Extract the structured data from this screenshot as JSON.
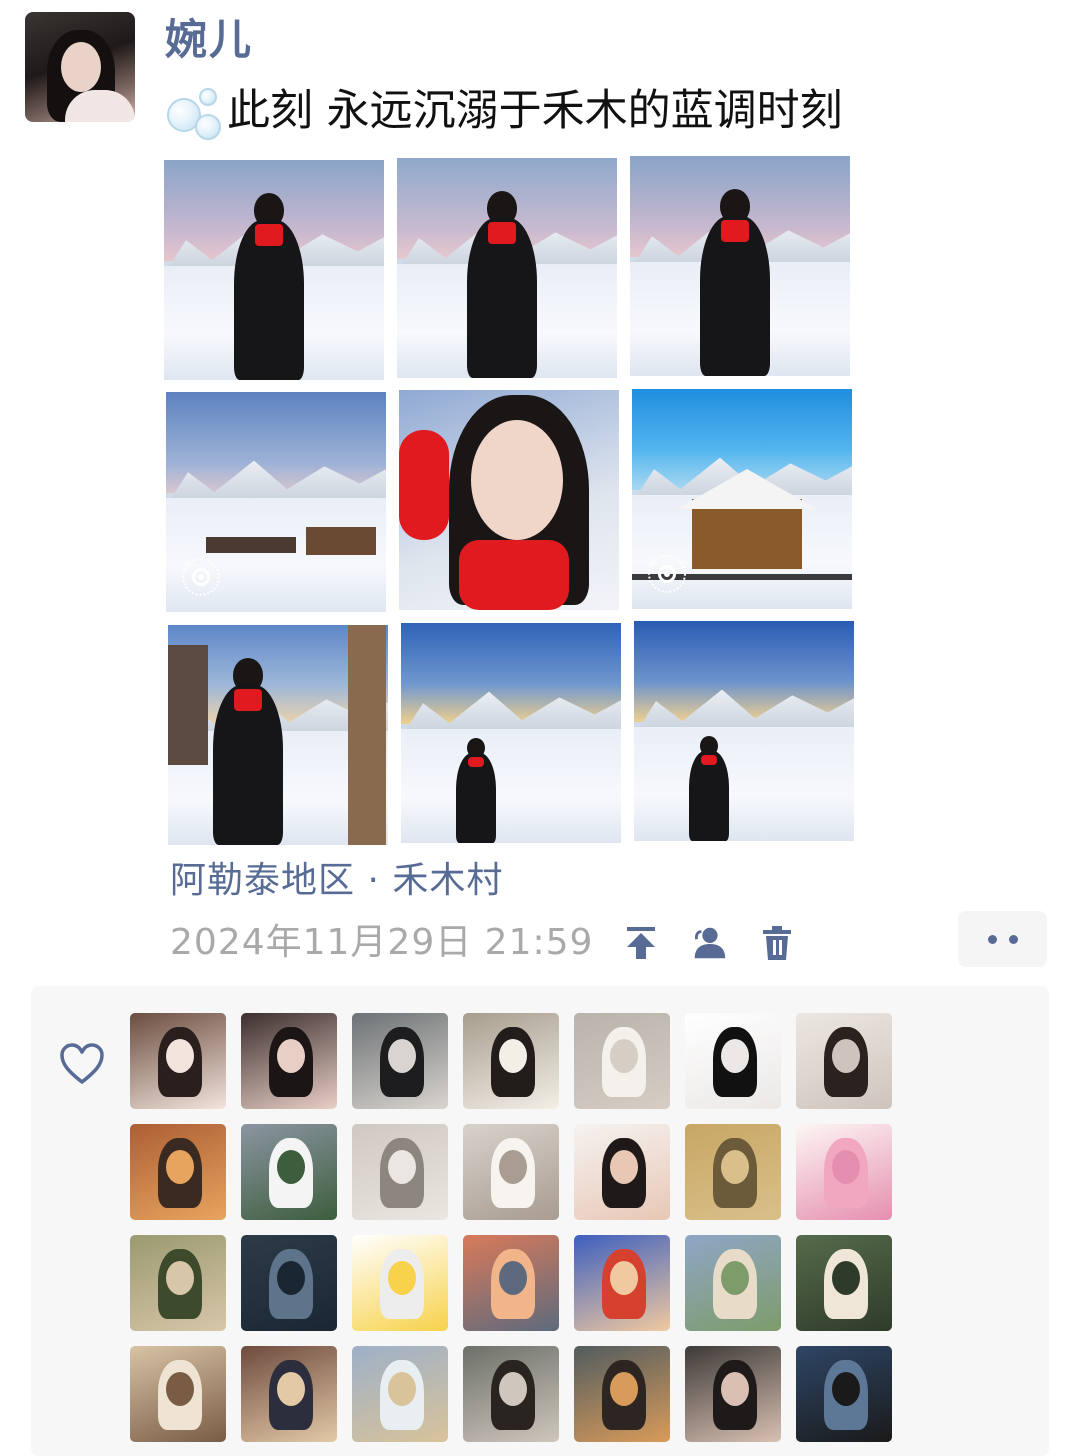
{
  "post": {
    "nickname": "婉儿",
    "text": "此刻 永远沉溺于禾木的蓝调时刻",
    "text_icon": "bubbles-emoji",
    "location": "阿勒泰地区 · 禾木村",
    "timestamp": "2024年11月29日 21:59"
  },
  "actions": {
    "pin_icon": "pin-to-top-icon",
    "visibility_icon": "friends-visibility-icon",
    "delete_icon": "trash-icon",
    "more_icon": "more-dots-icon"
  },
  "photos": [
    {
      "kind": "woman-snow",
      "live": false
    },
    {
      "kind": "woman-snow-arms",
      "live": false
    },
    {
      "kind": "woman-snow",
      "live": false
    },
    {
      "kind": "landscape-dusk",
      "live": true
    },
    {
      "kind": "selfie",
      "live": false
    },
    {
      "kind": "cabin-blue",
      "live": true
    },
    {
      "kind": "woman-cabin-dusk",
      "live": false
    },
    {
      "kind": "village-dusk-woman",
      "live": false
    },
    {
      "kind": "village-dusk-woman-far",
      "live": false
    }
  ],
  "likes": {
    "icon": "heart-outline-icon",
    "liker_count": 28
  },
  "colors": {
    "link": "#576b95",
    "timestamp": "#a9a9a9",
    "likes_bg": "#f7f7f7",
    "scarf_red": "#e01a1f"
  },
  "liker_hair_palettes": [
    [
      "#6b4d3f",
      "#2a1f1c",
      "#f2e4dc"
    ],
    [
      "#3c2f2e",
      "#1b1515",
      "#e8cfc6"
    ],
    [
      "#6d7275",
      "#1d1d1f",
      "#d9d4cf"
    ],
    [
      "#a79d8e",
      "#221c1b",
      "#f3efe7"
    ],
    [
      "#b9b3ac",
      "#f4f1ec",
      "#d6cdc4"
    ],
    [
      "#ffffff",
      "#111111",
      "#ebe8e6"
    ],
    [
      "#ece7e2",
      "#2b2220",
      "#cfc4bd"
    ],
    [
      "#ad5f35",
      "#3a2a22",
      "#e7a45e"
    ],
    [
      "#8b95a2",
      "#f4f4f4",
      "#3d5e3d"
    ],
    [
      "#cfc8c2",
      "#8d8580",
      "#ebe6e1"
    ],
    [
      "#d8d2cc",
      "#f7f4f0",
      "#a99c90"
    ],
    [
      "#f5f3f1",
      "#1f1a19",
      "#e8c7b5"
    ],
    [
      "#c8a765",
      "#6c5b3a",
      "#d9c08a"
    ],
    [
      "#fdf6f4",
      "#f2a7c0",
      "#e58fb0"
    ],
    [
      "#9a9a70",
      "#3d4a2c",
      "#d8c6a9"
    ],
    [
      "#2d3b49",
      "#5e748a",
      "#1a2733"
    ],
    [
      "#ffffff",
      "#ededed",
      "#f7d24a"
    ],
    [
      "#d97a5a",
      "#f2b489",
      "#5d6a7d"
    ],
    [
      "#3d5fbf",
      "#d6402f",
      "#f0c9a0"
    ],
    [
      "#8fa6c7",
      "#e8dcc8",
      "#7d9c6a"
    ],
    [
      "#556b4a",
      "#efe6d8",
      "#2f3b2a"
    ],
    [
      "#d8c3a5",
      "#efe4d4",
      "#7a5c45"
    ],
    [
      "#6d4b3e",
      "#2c2e3e",
      "#e4c9a7"
    ],
    [
      "#9db0c8",
      "#e9eef2",
      "#d9c39a"
    ],
    [
      "#6c7069",
      "#2a2421",
      "#cfc6bd"
    ],
    [
      "#515c5f",
      "#2c2522",
      "#d99b5a"
    ],
    [
      "#3d3a38",
      "#1e1a1a",
      "#d9c0b2"
    ],
    [
      "#2e4666",
      "#5c7896",
      "#1a1a1a"
    ]
  ]
}
